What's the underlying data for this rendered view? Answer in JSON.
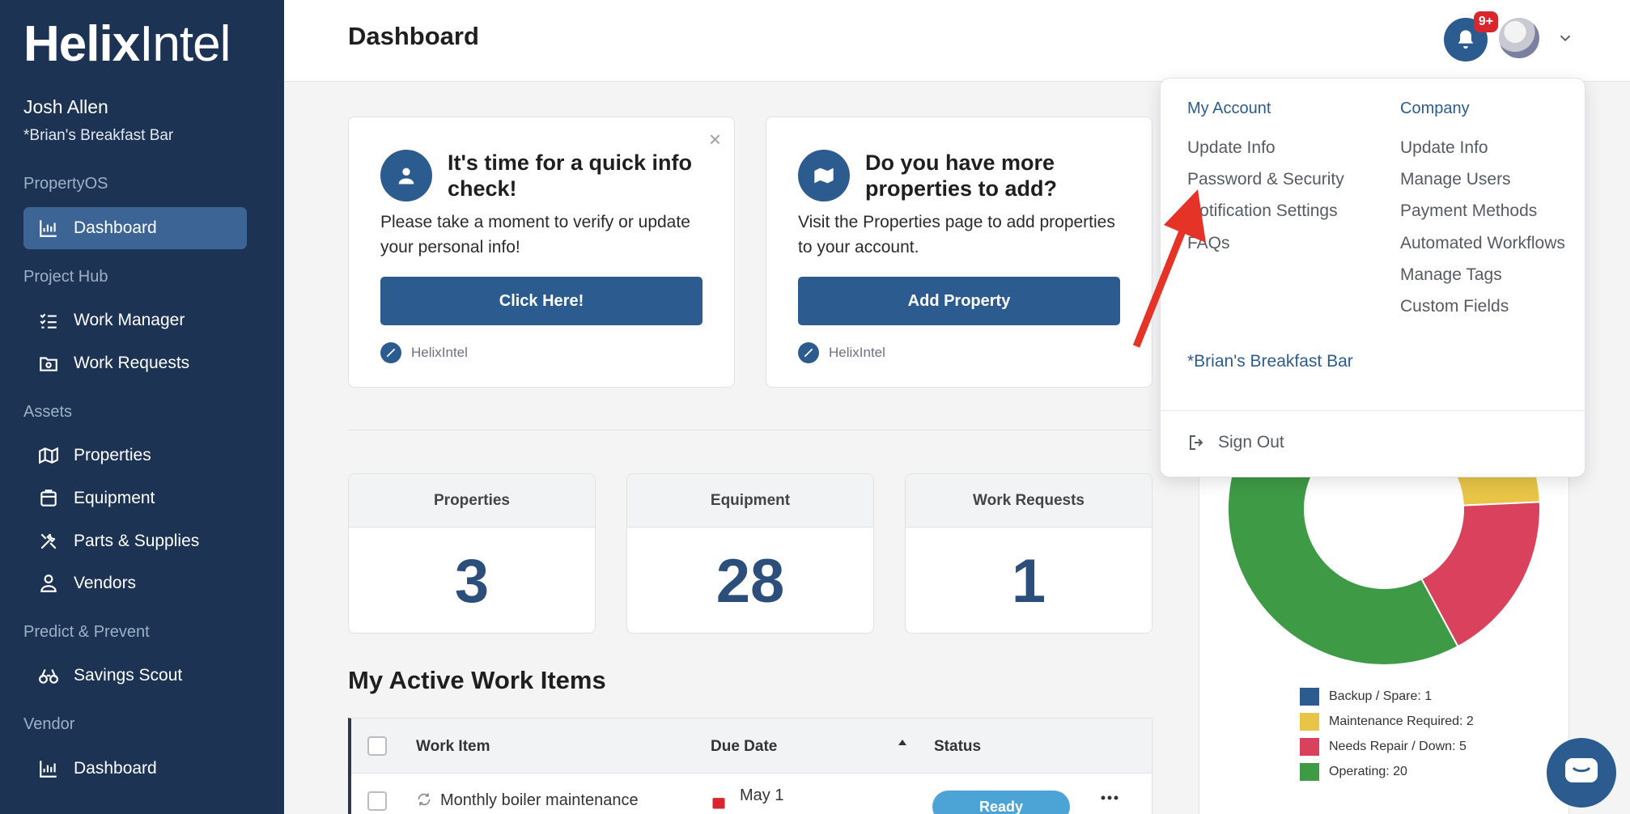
{
  "sidebar": {
    "logo_bold": "Helix",
    "logo_light": "Intel",
    "user_name": "Josh Allen",
    "company": "*Brian's Breakfast Bar",
    "sections": [
      {
        "label": "PropertyOS",
        "items": [
          {
            "label": "Dashboard",
            "icon": "chart-icon",
            "active": true
          }
        ]
      },
      {
        "label": "Project Hub",
        "items": [
          {
            "label": "Work Manager",
            "icon": "checklist-icon"
          },
          {
            "label": "Work Requests",
            "icon": "folder-gear-icon"
          }
        ]
      },
      {
        "label": "Assets",
        "items": [
          {
            "label": "Properties",
            "icon": "map-icon"
          },
          {
            "label": "Equipment",
            "icon": "box-icon"
          },
          {
            "label": "Parts & Supplies",
            "icon": "tools-icon"
          },
          {
            "label": "Vendors",
            "icon": "person-icon"
          }
        ]
      },
      {
        "label": "Predict & Prevent",
        "items": [
          {
            "label": "Savings Scout",
            "icon": "binoculars-icon"
          }
        ]
      },
      {
        "label": "Vendor",
        "items": [
          {
            "label": "Dashboard",
            "icon": "chart-icon"
          }
        ]
      }
    ]
  },
  "header": {
    "title": "Dashboard",
    "notification_badge": "9+"
  },
  "cards": [
    {
      "title": "It's time for a quick info check!",
      "body": "Please take a moment to verify or update your personal info!",
      "button": "Click Here!",
      "footer": "HelixIntel"
    },
    {
      "title": "Do you have more properties to add?",
      "body": "Visit the Properties page to add properties to your account.",
      "button": "Add Property",
      "footer": "HelixIntel"
    }
  ],
  "stats": [
    {
      "label": "Properties",
      "value": "3"
    },
    {
      "label": "Equipment",
      "value": "28"
    },
    {
      "label": "Work Requests",
      "value": "1"
    }
  ],
  "work_items": {
    "title": "My Active Work Items",
    "columns": [
      "Work Item",
      "Due Date",
      "Status"
    ],
    "rows": [
      {
        "name": "Monthly boiler maintenance",
        "due": "May 1",
        "status": "Ready"
      }
    ]
  },
  "dropdown": {
    "my_account": {
      "heading": "My Account",
      "items": [
        "Update Info",
        "Password & Security",
        "Notification Settings",
        "FAQs"
      ]
    },
    "company": {
      "heading": "Company",
      "items": [
        "Update Info",
        "Manage Users",
        "Payment Methods",
        "Automated Workflows",
        "Manage Tags",
        "Custom Fields"
      ]
    },
    "current_company": "*Brian's Breakfast Bar",
    "sign_out": "Sign Out"
  },
  "chart_data": {
    "type": "pie",
    "categories": [
      "Backup / Spare",
      "Maintenance Required",
      "Needs Repair / Down",
      "Operating"
    ],
    "values": [
      1,
      2,
      5,
      20
    ],
    "legend": [
      "Backup / Spare: 1",
      "Maintenance Required: 2",
      "Needs Repair / Down: 5",
      "Operating: 20"
    ],
    "colors": [
      "#2c5b8f",
      "#e8c547",
      "#d9415c",
      "#3e9a45"
    ]
  }
}
